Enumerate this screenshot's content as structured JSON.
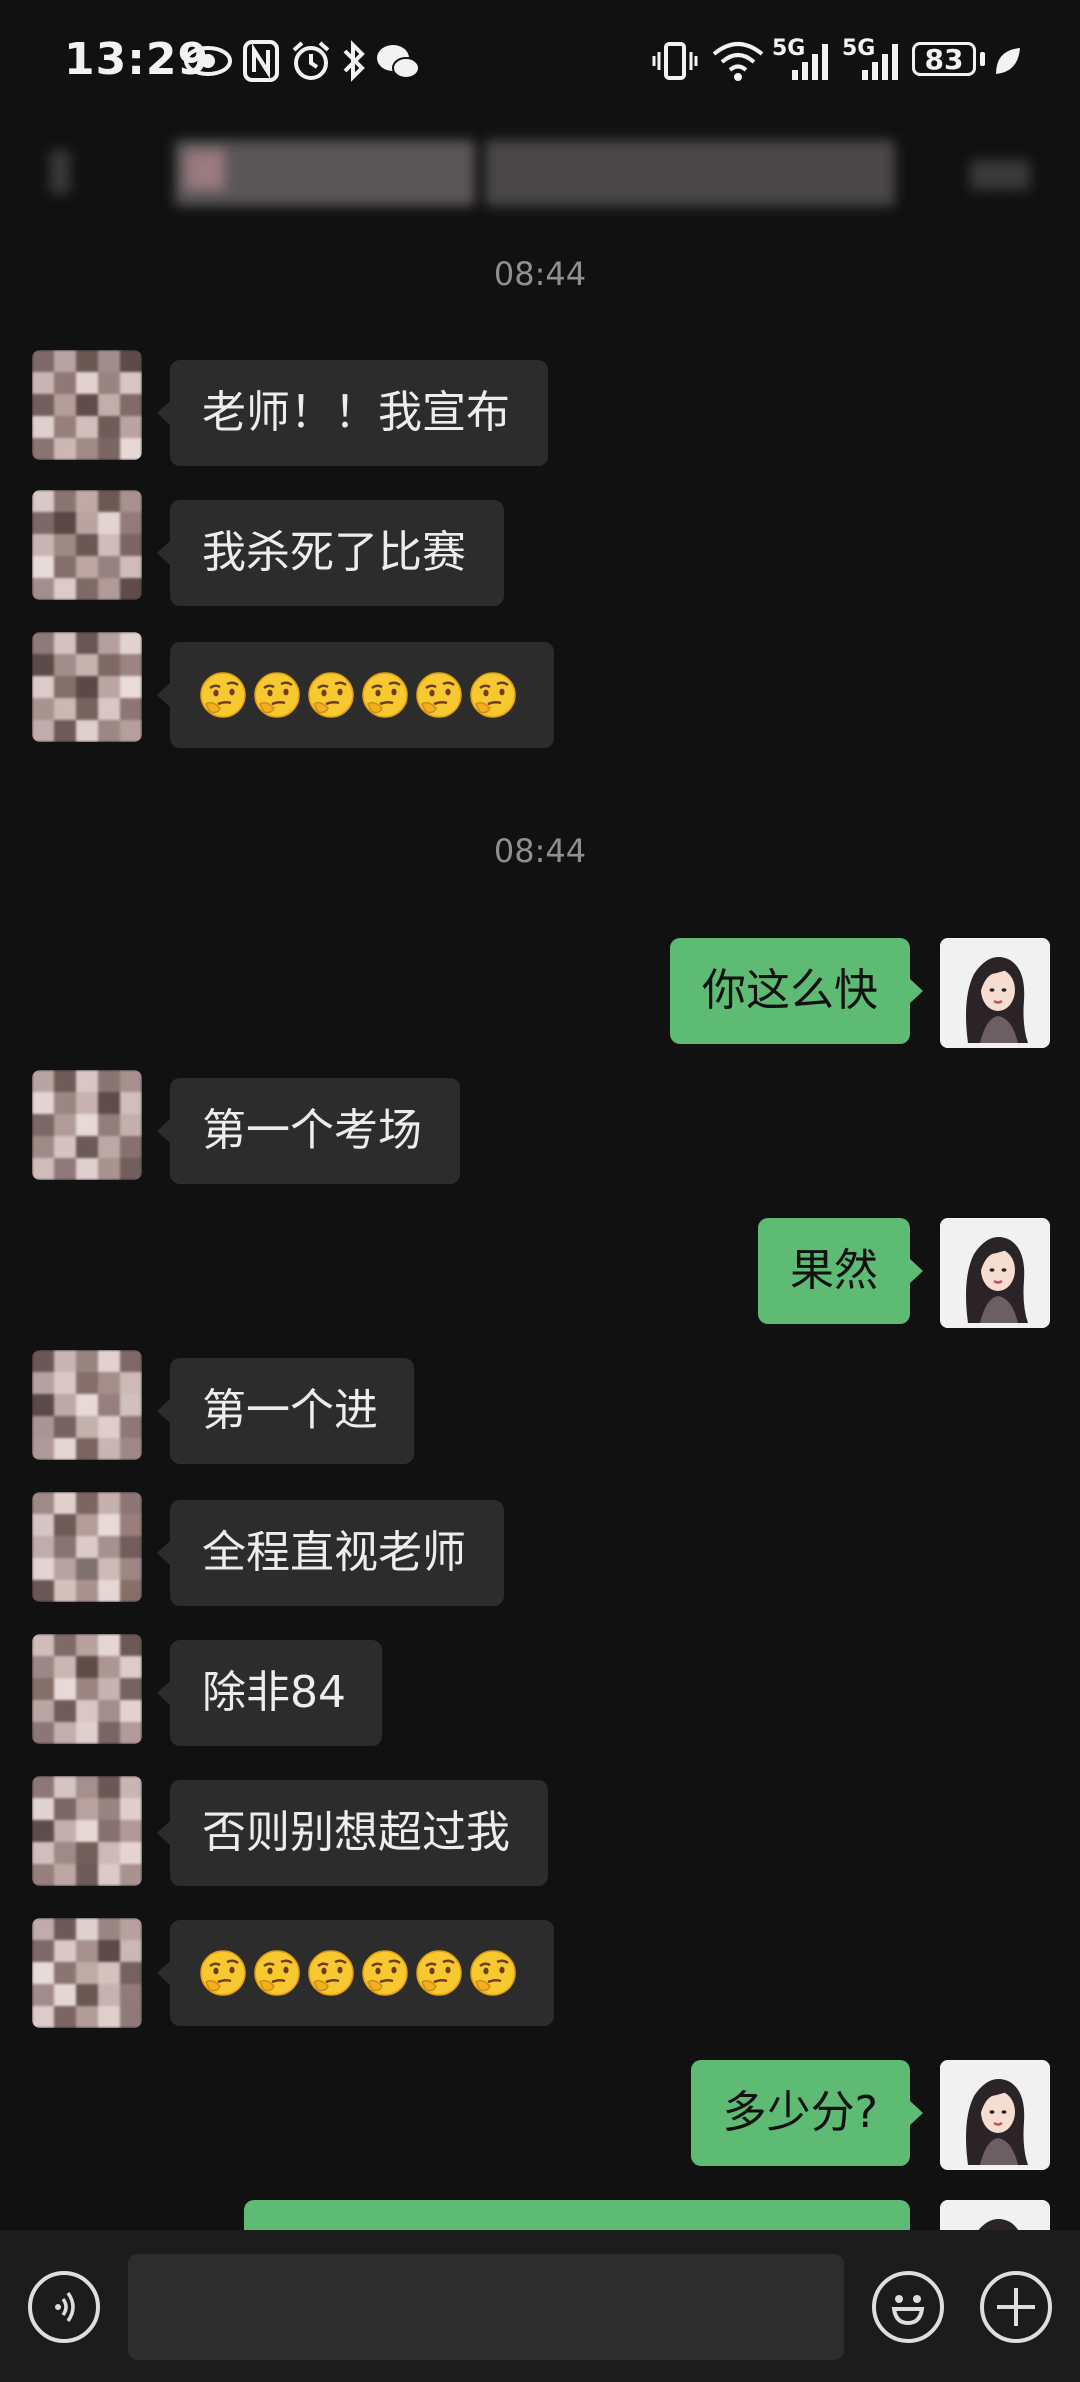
{
  "status_bar": {
    "time": "13:29",
    "battery": "83",
    "network_1": "5G",
    "network_2": "5G"
  },
  "chat": {
    "title": "",
    "messages": [
      {
        "type": "timestamp",
        "text": "08:44"
      },
      {
        "type": "in",
        "text": "老师！！我宣布"
      },
      {
        "type": "in",
        "text": "我杀死了比赛"
      },
      {
        "type": "in",
        "text": "",
        "emoji": "thinking-face",
        "emoji_count": 6
      },
      {
        "type": "timestamp",
        "text": "08:44"
      },
      {
        "type": "out",
        "text": "你这么快"
      },
      {
        "type": "in",
        "text": "第一个考场"
      },
      {
        "type": "out",
        "text": "果然"
      },
      {
        "type": "in",
        "text": "第一个进"
      },
      {
        "type": "in",
        "text": "全程直视老师"
      },
      {
        "type": "in",
        "text": "除非84"
      },
      {
        "type": "in",
        "text": "否则别想超过我"
      },
      {
        "type": "in",
        "text": "",
        "emoji": "thinking-face",
        "emoji_count": 6
      },
      {
        "type": "out",
        "text": "多少分?"
      },
      {
        "type": "out",
        "text": ""
      }
    ]
  },
  "input_bar": {
    "voice_icon": "voice-icon",
    "emoji_icon": "smiley-icon",
    "plus_icon": "plus-icon",
    "value": ""
  },
  "colors": {
    "background": "#111111",
    "incoming_bubble": "#2c2c2c",
    "outgoing_bubble": "#5dbb74",
    "timestamp": "#8f8f8f"
  }
}
